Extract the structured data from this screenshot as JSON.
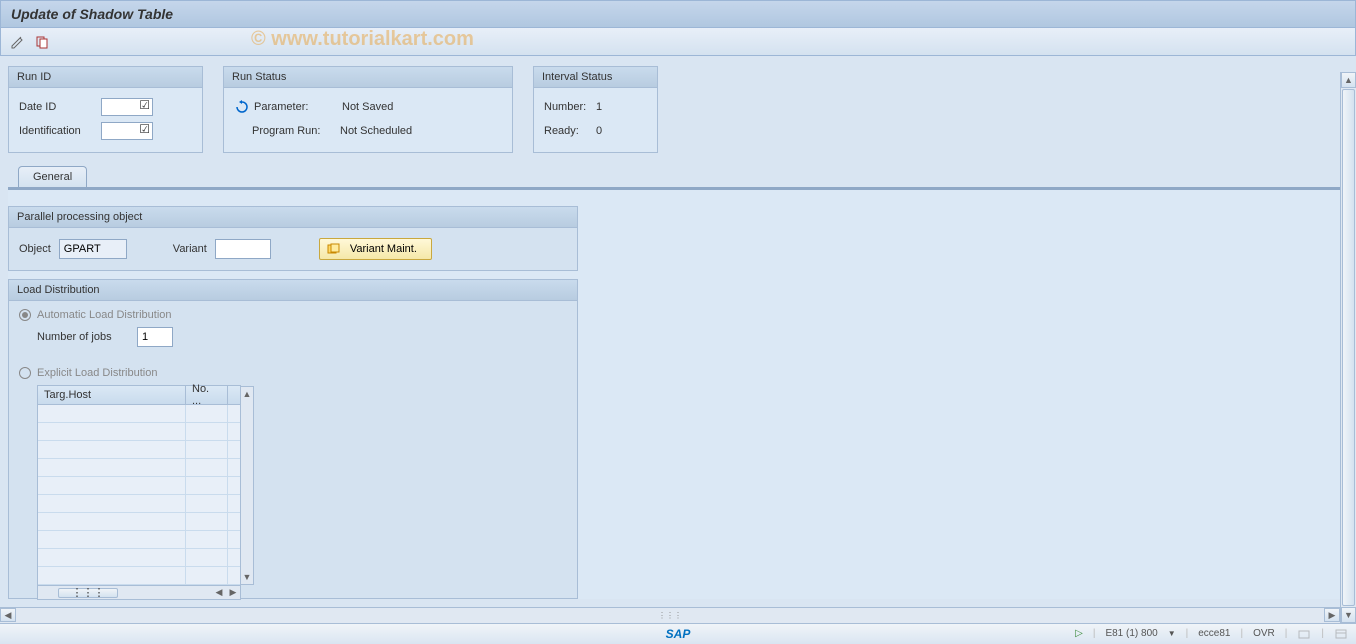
{
  "title": "Update of Shadow Table",
  "watermark": "© www.tutorialkart.com",
  "groups": {
    "run_id": {
      "title": "Run ID",
      "date_id_label": "Date ID",
      "identification_label": "Identification"
    },
    "run_status": {
      "title": "Run Status",
      "parameter_label": "Parameter:",
      "parameter_value": "Not Saved",
      "program_run_label": "Program Run:",
      "program_run_value": "Not Scheduled"
    },
    "interval_status": {
      "title": "Interval Status",
      "number_label": "Number:",
      "number_value": "1",
      "ready_label": "Ready:",
      "ready_value": "0"
    }
  },
  "tabs": {
    "general": "General"
  },
  "parallel": {
    "title": "Parallel processing object",
    "object_label": "Object",
    "object_value": "GPART",
    "variant_label": "Variant",
    "variant_value": "",
    "variant_maint_btn": "Variant Maint."
  },
  "load": {
    "title": "Load Distribution",
    "automatic_label": "Automatic Load Distribution",
    "num_jobs_label": "Number of jobs",
    "num_jobs_value": "1",
    "explicit_label": "Explicit Load Distribution",
    "table": {
      "col1": "Targ.Host",
      "col2": "No. ..."
    }
  },
  "status": {
    "system": "E81 (1) 800",
    "server": "ecce81",
    "mode": "OVR",
    "sap": "SAP"
  }
}
